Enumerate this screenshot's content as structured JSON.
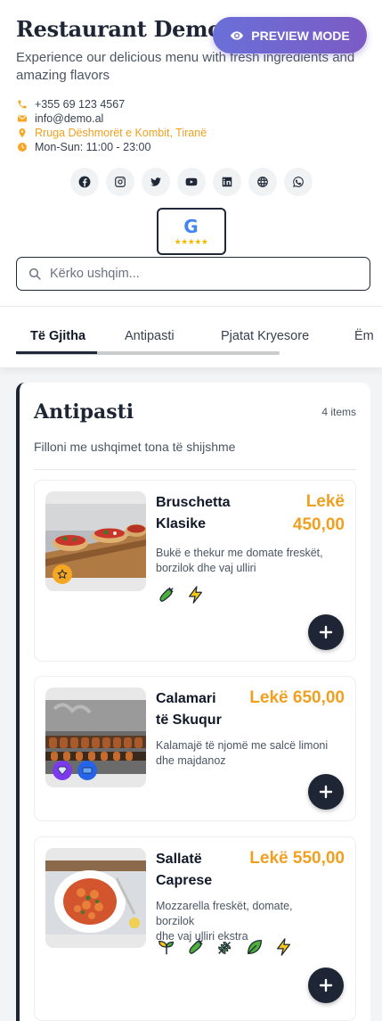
{
  "header": {
    "title": "Restaurant Demo",
    "subtitle": "Experience our delicious menu with fresh ingredients and amazing flavors",
    "preview_label": "PREVIEW MODE"
  },
  "contacts": {
    "phone": "+355 69 123 4567",
    "email": "info@demo.al",
    "address": "Rruga Dëshmorët e Kombit, Tiranë",
    "hours": "Mon-Sun: 11:00 - 23:00"
  },
  "socials": [
    "facebook-icon",
    "instagram-icon",
    "twitter-icon",
    "youtube-icon",
    "linkedin-icon",
    "globe-icon",
    "whatsapp-icon"
  ],
  "google_badge": {
    "letter": "G",
    "stars": "★★★★★"
  },
  "search": {
    "placeholder": "Kërko ushqim..."
  },
  "tabs": [
    {
      "label": "Të Gjitha",
      "active": true
    },
    {
      "label": "Antipasti",
      "active": false
    },
    {
      "label": "Pjatat Kryesore",
      "active": false
    },
    {
      "label": "Ëm",
      "active": false
    }
  ],
  "section": {
    "title": "Antipasti",
    "count": "4 items",
    "description": "Filloni me ushqimet tona të shijshme"
  },
  "items": [
    {
      "name_line1": "Bruschetta",
      "name_line2": "Klasike",
      "price_line1": "Lekë",
      "price_line2": "450,00",
      "desc_line1": "Bukë e thekur me domate freskët,",
      "desc_line2": "borzilok dhe vaj ulliri",
      "badges": [
        "star-icon"
      ],
      "tags": [
        "vegetable-icon",
        "spicy-bolt-icon"
      ]
    },
    {
      "name_line1": "Calamari",
      "name_line2": "të Skuqur",
      "price_line1": "Lekë 650,00",
      "desc_line1": "Kalamajë të njomë me salcë limoni",
      "desc_line2": "dhe majdanoz",
      "badges": [
        "gem-icon",
        "new-icon"
      ],
      "tags": []
    },
    {
      "name_line1": "Sallatë",
      "name_line2": "Caprese",
      "price_line1": "Lekë 550,00",
      "desc_line1": "Mozzarella freskët, domate, borzilok",
      "desc_line2": "dhe vaj ulliri ekstra",
      "badges": [],
      "tags": [
        "sprout-icon",
        "vegetable-icon",
        "wheat-icon",
        "leaf-icon",
        "spicy-bolt-icon"
      ]
    }
  ],
  "colors": {
    "accent": "#f0a020",
    "dark": "#1e2535",
    "preview_gradient_start": "#6a6fd8",
    "preview_gradient_end": "#7c5bc4"
  }
}
